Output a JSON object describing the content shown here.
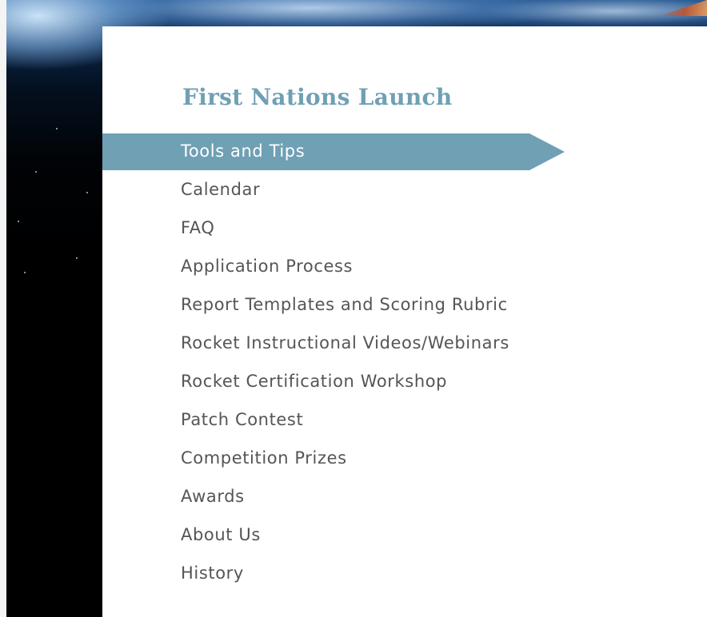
{
  "site": {
    "title": "First Nations Launch"
  },
  "nav": {
    "active_index": 0,
    "items": [
      {
        "label": "Tools and Tips",
        "active": true
      },
      {
        "label": "Calendar",
        "active": false
      },
      {
        "label": "FAQ",
        "active": false
      },
      {
        "label": "Application Process",
        "active": false
      },
      {
        "label": "Report Templates and Scoring Rubric",
        "active": false
      },
      {
        "label": "Rocket Instructional Videos/Webinars",
        "active": false
      },
      {
        "label": "Rocket Certification Workshop",
        "active": false
      },
      {
        "label": "Patch Contest",
        "active": false
      },
      {
        "label": "Competition Prizes",
        "active": false
      },
      {
        "label": "Awards",
        "active": false
      },
      {
        "label": "About Us",
        "active": false
      },
      {
        "label": "History",
        "active": false
      }
    ]
  },
  "colors": {
    "accent": "#6fa0b4",
    "text": "#555555",
    "active_text": "#ffffff",
    "panel": "#ffffff",
    "space": "#000000"
  }
}
